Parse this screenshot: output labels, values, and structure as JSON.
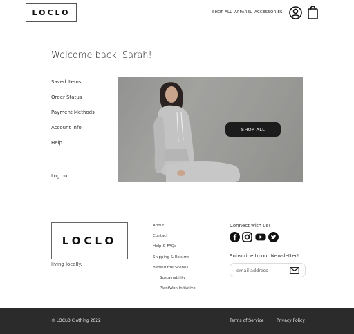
{
  "header": {
    "logo": "LOCLO",
    "nav": [
      "SHOP ALL",
      "APPAREL",
      "ACCESSORIES"
    ],
    "account_icon": "account-circle-icon",
    "bag_icon": "shopping-bag-icon"
  },
  "main": {
    "welcome": "Welcome back, Sarah!",
    "sidebar": [
      "Saved Items",
      "Order Status",
      "Payment Methods",
      "Account Info",
      "Help"
    ],
    "logout": "Log out",
    "hero_button": "SHOP ALL"
  },
  "footer": {
    "logo": "LOCLO",
    "tagline": "living locally.",
    "links": [
      "About",
      "Contact",
      "Help & FAQs",
      "Shipping & Returns",
      "Behind the Scenes"
    ],
    "sublinks": [
      "Sustainability",
      "PlantWon Initiative"
    ],
    "connect": "Connect with us!",
    "social_icons": [
      "facebook-icon",
      "instagram-icon",
      "youtube-icon",
      "twitter-icon"
    ],
    "subscribe": "Subscribe to our Newsletter!",
    "email_placeholder": "email address",
    "copyright": "© LOCLO Clothing 2022",
    "terms": "Terms of Service",
    "privacy": "Privacy Policy"
  },
  "colors": {
    "footer_bg": "#2b2b2b",
    "button_bg": "#1c1c1c"
  }
}
